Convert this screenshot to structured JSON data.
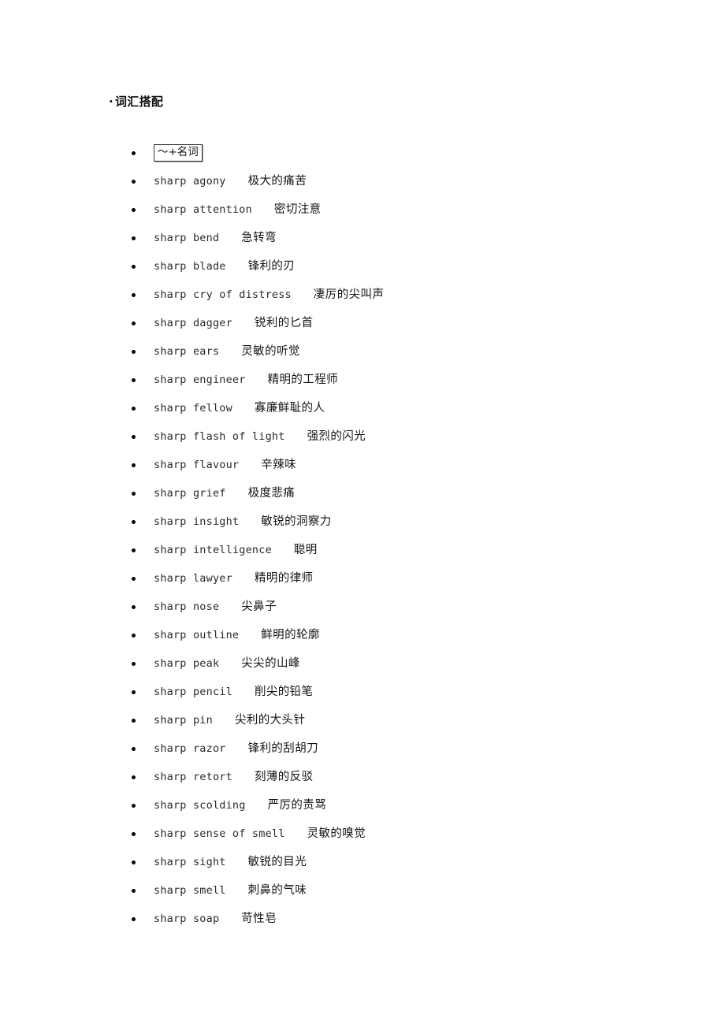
{
  "document": {
    "section_heading": {
      "lead_dot": "·",
      "text": "词汇搭配"
    },
    "pattern_label": "～+名词",
    "entries": [
      {
        "en": "sharp agony",
        "gap": 4,
        "zh": "极大的痛苦"
      },
      {
        "en": "sharp attention",
        "gap": 4,
        "zh": "密切注意"
      },
      {
        "en": "sharp bend",
        "gap": 4,
        "zh": "急转弯"
      },
      {
        "en": "sharp blade",
        "gap": 4,
        "zh": "锋利的刃"
      },
      {
        "en": "sharp cry of distress",
        "gap": 4,
        "zh": "凄厉的尖叫声"
      },
      {
        "en": "sharp dagger",
        "gap": 4,
        "zh": "锐利的匕首"
      },
      {
        "en": "sharp ears",
        "gap": 4,
        "zh": "灵敏的听觉"
      },
      {
        "en": "sharp engineer",
        "gap": 4,
        "zh": "精明的工程师"
      },
      {
        "en": "sharp fellow",
        "gap": 4,
        "zh": "寡廉鲜耻的人"
      },
      {
        "en": "sharp flash of light",
        "gap": 4,
        "zh": "强烈的闪光"
      },
      {
        "en": "sharp flavour",
        "gap": 4,
        "zh": "辛辣味"
      },
      {
        "en": "sharp grief",
        "gap": 4,
        "zh": "极度悲痛"
      },
      {
        "en": "sharp insight",
        "gap": 4,
        "zh": "敏锐的洞察力"
      },
      {
        "en": "sharp intelligence",
        "gap": 4,
        "zh": "聪明"
      },
      {
        "en": "sharp lawyer",
        "gap": 4,
        "zh": "精明的律师"
      },
      {
        "en": "sharp nose",
        "gap": 4,
        "zh": "尖鼻子"
      },
      {
        "en": "sharp outline",
        "gap": 4,
        "zh": "鲜明的轮廓"
      },
      {
        "en": "sharp peak",
        "gap": 4,
        "zh": "尖尖的山峰"
      },
      {
        "en": "sharp pencil",
        "gap": 4,
        "zh": "削尖的铅笔"
      },
      {
        "en": "sharp pin",
        "gap": 4,
        "zh": "尖利的大头针"
      },
      {
        "en": "sharp razor",
        "gap": 4,
        "zh": "锋利的刮胡刀"
      },
      {
        "en": "sharp retort",
        "gap": 4,
        "zh": "刻薄的反驳"
      },
      {
        "en": "sharp scolding",
        "gap": 4,
        "zh": "严厉的责骂"
      },
      {
        "en": "sharp sense of smell",
        "gap": 4,
        "zh": "灵敏的嗅觉"
      },
      {
        "en": "sharp sight",
        "gap": 4,
        "zh": "敏锐的目光"
      },
      {
        "en": "sharp smell",
        "gap": 4,
        "zh": "刺鼻的气味"
      },
      {
        "en": "sharp soap",
        "gap": 4,
        "zh": "苛性皂"
      }
    ]
  }
}
